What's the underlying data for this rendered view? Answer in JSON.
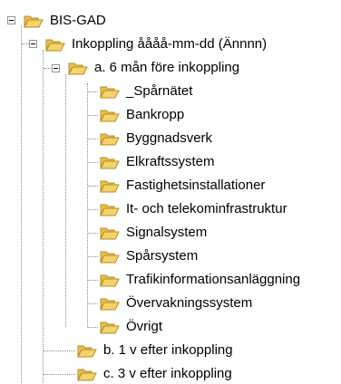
{
  "tree": {
    "root": {
      "label": "BIS-GAD",
      "child": {
        "label": "Inkoppling åååå-mm-dd (Ännnn)",
        "children": [
          {
            "label": "a. 6 mån före inkoppling",
            "children": [
              "_Spårnätet",
              "Bankropp",
              "Byggnadsverk",
              "Elkraftssystem",
              "Fastighetsinstallationer",
              "It- och telekominfrastruktur",
              "Signalsystem",
              "Spårsystem",
              "Trafikinformationsanläggning",
              "Övervakningssystem",
              "Övrigt"
            ]
          },
          {
            "label": "b. 1 v efter inkoppling"
          },
          {
            "label": "c. 3 v efter inkoppling"
          }
        ]
      }
    }
  },
  "icons": {
    "expanded": "minus-box-icon",
    "folder": "open-folder-icon"
  },
  "colors": {
    "folder_fill": "#f4d36a",
    "folder_edge": "#c9a43a",
    "tree_lines": "#8a8a8a"
  }
}
